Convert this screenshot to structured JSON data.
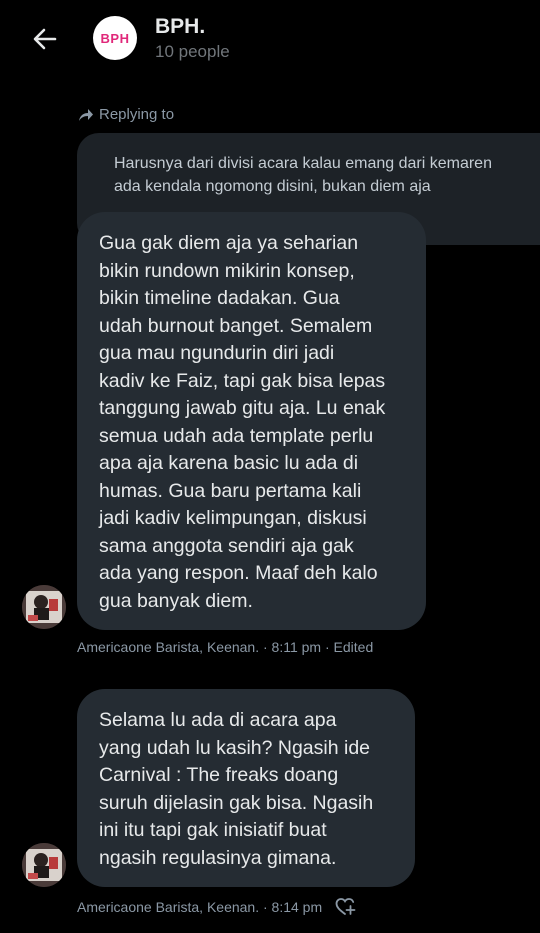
{
  "header": {
    "group_avatar_text": "BPH",
    "group_name": "BPH.",
    "member_count": "10 people"
  },
  "reply": {
    "label": "Replying to",
    "quoted_lines": [
      "Harusnya dari divisi acara kalau emang dari kemaren",
      "ada kendala ngomong disini, bukan diem aja"
    ]
  },
  "messages": [
    {
      "lines": [
        "Gua gak diem aja ya seharian",
        "bikin rundown mikirin konsep,",
        "bikin timeline dadakan. Gua",
        "udah burnout banget. Semalem",
        "gua mau ngundurin diri jadi",
        "kadiv ke Faiz, tapi gak bisa lepas",
        "tanggung jawab gitu aja. Lu enak",
        "semua udah ada template perlu",
        "apa aja karena basic lu ada di",
        "humas. Gua baru pertama kali",
        "jadi kadiv kelimpungan, diskusi",
        "sama anggota sendiri aja gak",
        "ada yang respon. Maaf deh kalo",
        "gua banyak diem."
      ],
      "meta": "Americaone Barista, Keenan. · 8:11 pm · Edited"
    },
    {
      "lines": [
        "Selama lu ada di acara apa",
        "yang udah lu kasih? Ngasih ide",
        "Carnival : The freaks doang",
        "suruh dijelasin gak bisa. Ngasih",
        "ini itu tapi gak inisiatif buat",
        "ngasih regulasinya gimana."
      ],
      "meta": "Americaone Barista, Keenan. · 8:14 pm"
    }
  ],
  "colors": {
    "background": "#000000",
    "bubble": "#252c33",
    "quoted_bubble": "#1d2227",
    "secondary_text": "#8b98a5",
    "brand": "#e0287a"
  },
  "icons": [
    "back-arrow-icon",
    "reply-arrow-icon",
    "add-reaction-heart-icon"
  ]
}
